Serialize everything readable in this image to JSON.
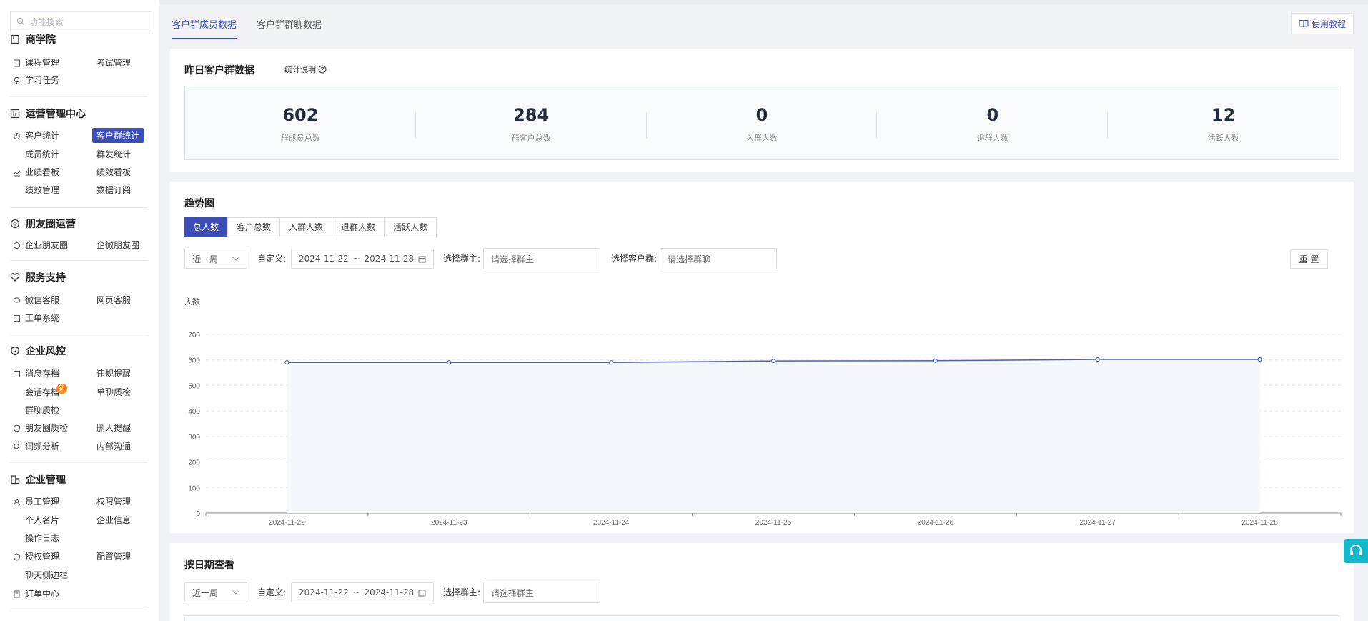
{
  "sidebar": {
    "search_placeholder": "功能搜索",
    "sections": [
      {
        "title": "商学院",
        "items": [
          "课程管理",
          "考试管理",
          "学习任务"
        ]
      },
      {
        "title": "运营管理中心",
        "items": [
          "客户统计",
          "客户群统计",
          "成员统计",
          "群发统计",
          "业绩看板",
          "绩效看板",
          "绩效管理",
          "数据订阅"
        ]
      },
      {
        "title": "朋友圈运营",
        "items": [
          "企业朋友圈",
          "企微朋友圈"
        ]
      },
      {
        "title": "服务支持",
        "items": [
          "微信客服",
          "网页客服",
          "工单系统"
        ]
      },
      {
        "title": "企业风控",
        "items": [
          "消息存档",
          "违规提醒",
          "会话存档",
          "单聊质检",
          "群聊质检",
          "朋友圈质检",
          "删人提醒",
          "词频分析",
          "内部沟通"
        ]
      },
      {
        "title": "企业管理",
        "items": [
          "员工管理",
          "权限管理",
          "个人名片",
          "企业信息",
          "操作日志",
          "授权管理",
          "配置管理",
          "聊天侧边栏",
          "订单中心"
        ]
      }
    ],
    "badge_new": "新"
  },
  "tabs": [
    "客户群成员数据",
    "客户群群聊数据"
  ],
  "help_button": "使用教程",
  "yesterday": {
    "title": "昨日客户群数据",
    "note": "统计说明",
    "stats": [
      {
        "value": "602",
        "label": "群成员总数"
      },
      {
        "value": "284",
        "label": "群客户总数"
      },
      {
        "value": "0",
        "label": "入群人数"
      },
      {
        "value": "0",
        "label": "退群人数"
      },
      {
        "value": "12",
        "label": "活跃人数"
      }
    ]
  },
  "trend": {
    "title": "趋势图",
    "segments": [
      "总人数",
      "客户总数",
      "入群人数",
      "退群人数",
      "活跃人数"
    ],
    "range_select": "近一周",
    "custom_label": "自定义:",
    "date_start": "2024-11-22",
    "date_sep": "~",
    "date_end": "2024-11-28",
    "owner_label": "选择群主:",
    "owner_placeholder": "请选择群主",
    "group_label": "选择客户群:",
    "group_placeholder": "请选择群聊",
    "reset": "重 置"
  },
  "chart_data": {
    "type": "area",
    "ylabel": "人数",
    "ylim": [
      0,
      700
    ],
    "yticks": [
      0,
      100,
      200,
      300,
      400,
      500,
      600,
      700
    ],
    "x": [
      "2024-11-22",
      "2024-11-23",
      "2024-11-24",
      "2024-11-25",
      "2024-11-26",
      "2024-11-27",
      "2024-11-28"
    ],
    "series": [
      {
        "values": [
          590,
          590,
          590,
          596,
          597,
          602,
          602
        ]
      }
    ],
    "line_color": "#4a5fc1",
    "fill_color": "#f4f7fc",
    "grid": true
  },
  "by_date": {
    "title": "按日期查看",
    "range_select": "近一周",
    "custom_label": "自定义:",
    "date_start": "2024-11-22",
    "date_sep": "~",
    "date_end": "2024-11-28",
    "owner_label": "选择群主:",
    "owner_placeholder": "请选择群主"
  }
}
